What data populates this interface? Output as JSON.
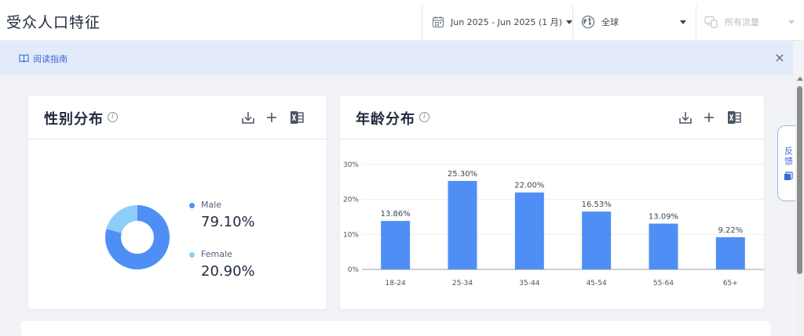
{
  "header": {
    "title": "受众人口特征",
    "date_range": "Jun 2025 - Jun 2025 (1 月)",
    "region": "全球",
    "traffic": "所有流量"
  },
  "guide": {
    "label": "阅读指南",
    "close": "×"
  },
  "side_tab": {
    "label": "反馈"
  },
  "colors": {
    "male": "#4f8ff5",
    "female": "#8ecdf7",
    "bar": "#4f8ff5",
    "accent": "#3a6ad6"
  },
  "icons": [
    "calendar-icon",
    "globe-icon",
    "devices-icon",
    "book-icon",
    "close-icon",
    "info-icon",
    "download-icon",
    "plus-icon",
    "excel-icon",
    "feedback-icon"
  ],
  "gender": {
    "title": "性别分布",
    "male_label": "Male",
    "male_value": "79.10%",
    "female_label": "Female",
    "female_value": "20.90%"
  },
  "age": {
    "title": "年龄分布"
  },
  "chart_data": [
    {
      "type": "pie",
      "categories": [
        "Male",
        "Female"
      ],
      "values": [
        79.1,
        20.9
      ]
    },
    {
      "type": "bar",
      "categories": [
        "18-24",
        "25-34",
        "35-44",
        "45-54",
        "55-64",
        "65+"
      ],
      "values": [
        13.86,
        25.3,
        22.0,
        16.53,
        13.09,
        9.22
      ],
      "data_labels": [
        "13.86%",
        "25.30%",
        "22.00%",
        "16.53%",
        "13.09%",
        "9.22%"
      ],
      "yticks": [
        "0%",
        "10%",
        "20%",
        "30%"
      ],
      "ylim": [
        0,
        30
      ],
      "grid": true
    }
  ]
}
